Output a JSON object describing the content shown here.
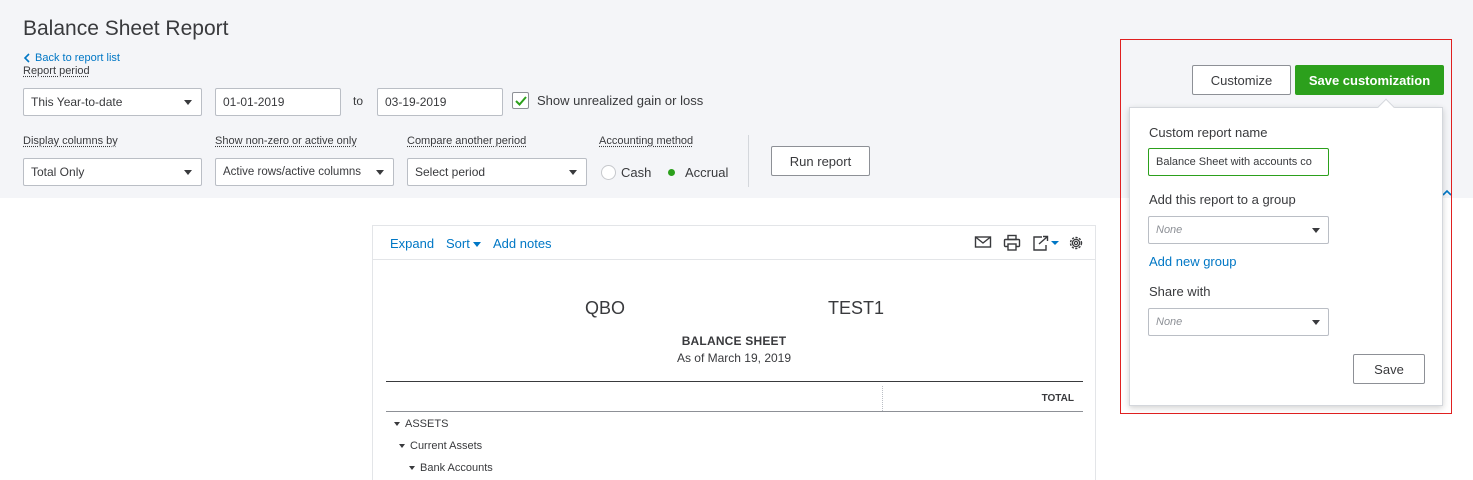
{
  "page": {
    "title": "Balance Sheet Report",
    "back_link": "Back to report list"
  },
  "filters": {
    "report_period_label": "Report period",
    "report_period_value": "This Year-to-date",
    "date_from": "01-01-2019",
    "to_label": "to",
    "date_to": "03-19-2019",
    "unrealized_label": "Show unrealized gain or loss",
    "unrealized_checked": true,
    "display_columns_label": "Display columns by",
    "display_columns_value": "Total Only",
    "nonzero_label": "Show non-zero or active only",
    "nonzero_value": "Active rows/active columns",
    "compare_label": "Compare another period",
    "compare_value": "Select period",
    "accounting_label": "Accounting method",
    "accounting_options": [
      "Cash",
      "Accrual"
    ],
    "accounting_selected": "Accrual",
    "run_report": "Run report"
  },
  "actions": {
    "customize": "Customize",
    "save_customization": "Save customization"
  },
  "report": {
    "toolbar": {
      "expand": "Expand",
      "sort": "Sort",
      "add_notes": "Add notes"
    },
    "company_left": "QBO",
    "company_right": "TEST1",
    "title": "BALANCE SHEET",
    "subtitle": "As of March 19, 2019",
    "column_header": "TOTAL",
    "rows": [
      {
        "label": "ASSETS",
        "level": 0
      },
      {
        "label": "Current Assets",
        "level": 1
      },
      {
        "label": "Bank Accounts",
        "level": 2
      }
    ]
  },
  "save_popup": {
    "name_label": "Custom report name",
    "name_value": "Balance Sheet with accounts co",
    "group_label": "Add this report to a group",
    "group_value": "None",
    "add_group_link": "Add new group",
    "share_label": "Share with",
    "share_value": "None",
    "save_button": "Save"
  },
  "colors": {
    "accent_green": "#2ca01c",
    "link_blue": "#0077c5",
    "highlight_red": "#e02020"
  }
}
